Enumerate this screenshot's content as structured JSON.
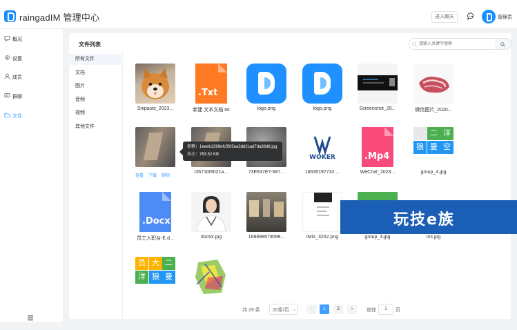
{
  "header": {
    "app_title": "raingadIM 管理中心",
    "chat_button": "进入聊天",
    "admin_name": "管理员"
  },
  "sidebar": {
    "items": [
      {
        "label": "概况",
        "icon": "chat-bubble-icon"
      },
      {
        "label": "设置",
        "icon": "gear-icon"
      },
      {
        "label": "成员",
        "icon": "user-icon"
      },
      {
        "label": "群聊",
        "icon": "group-chat-icon"
      },
      {
        "label": "文件",
        "icon": "folder-icon",
        "active": true
      }
    ]
  },
  "content": {
    "title": "文件列表",
    "search_placeholder": "请输入关键字搜索"
  },
  "categories": [
    {
      "label": "所有文件",
      "active": true
    },
    {
      "label": "文档"
    },
    {
      "label": "图片"
    },
    {
      "label": "音频"
    },
    {
      "label": "视频"
    },
    {
      "label": "其他文件"
    }
  ],
  "files": [
    {
      "name": "Snipaste_2023...",
      "kind": "photo-dog"
    },
    {
      "name": "新建 文本文档.txt",
      "kind": "doc",
      "ext": ".Txt",
      "color": "#ff7a22"
    },
    {
      "name": "logo.png",
      "kind": "app-logo"
    },
    {
      "name": "logo.png",
      "kind": "app-logo"
    },
    {
      "name": "Screenshot_20...",
      "kind": "screenshot-dark"
    },
    {
      "name": "微信图片_2020...",
      "kind": "photo-meat"
    },
    {
      "name": "",
      "kind": "photo-room",
      "hovered": true
    },
    {
      "name": "cf671bf9021a...",
      "kind": "photo-room"
    },
    {
      "name": "73E837E7-687...",
      "kind": "photo-blur"
    },
    {
      "name": "16635197732 ...",
      "kind": "logo-woker"
    },
    {
      "name": "WeChat_2023...",
      "kind": "doc",
      "ext": ".Mp4",
      "color": "#f94a7c"
    },
    {
      "name": "group_4.jpg",
      "kind": "group-tiles-a"
    },
    {
      "name": "员工入职台卡.d...",
      "kind": "doc",
      "ext": ".Docx",
      "color": "#4d8cf5"
    },
    {
      "name": "doctor.jpg",
      "kind": "photo-doctor"
    },
    {
      "name": "168898679099...",
      "kind": "photo-street"
    },
    {
      "name": "IMG_3252.png",
      "kind": "screenshot-phone"
    },
    {
      "name": "group_3.jpg",
      "kind": "group-tiles-b"
    },
    {
      "name": "ms.jpg",
      "kind": "plain"
    },
    {
      "name": "",
      "kind": "group-tiles-c"
    },
    {
      "name": "",
      "kind": "map-colorful"
    }
  ],
  "hover_actions": [
    "查看",
    "下载",
    "删除"
  ],
  "tooltip": {
    "name_line": "名称：1eeeb1399efcf505ea3dd2cad7da38d8.jpg",
    "size_line": "大小：763.52 KB"
  },
  "group_tiles_a": [
    "二",
    "洋",
    "狼",
    "曼",
    "空"
  ],
  "group_tiles_c": [
    "员",
    "大",
    "二",
    "洋",
    "狼",
    "曼"
  ],
  "pagination": {
    "total": "共 29 条",
    "page_size": "20条/页",
    "pages": [
      "1",
      "2"
    ],
    "current": "1",
    "jump_label": "前往",
    "jump_value": "1",
    "page_suffix": "页"
  },
  "watermark": "玩技e族",
  "colors": {
    "accent": "#409eff",
    "brand": "#1890ff"
  }
}
